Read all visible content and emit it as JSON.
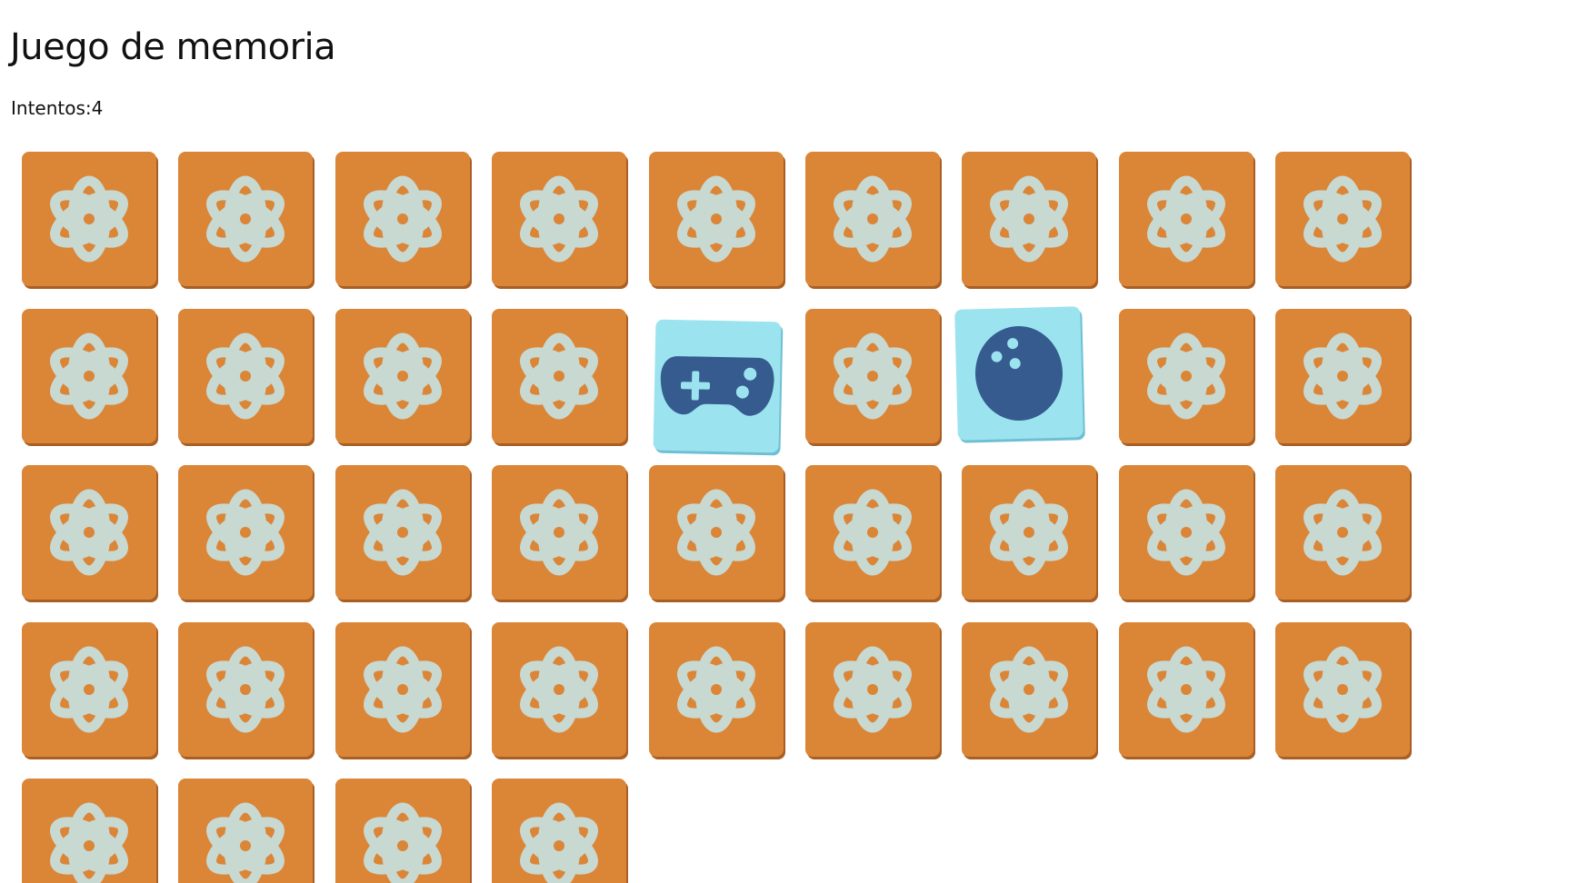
{
  "page": {
    "title": "Juego de memoria",
    "attempts_label": "Intentos:",
    "attempts_value": "4",
    "attempts_text": "Intentos:4"
  },
  "colors": {
    "card_back": "#db8537",
    "card_back_shadow": "#a95f24",
    "card_symbol": "#c8d9d2",
    "card_front": "#9ce3f0",
    "front_icon": "#355b8f"
  },
  "board": {
    "columns": 9,
    "cards": [
      {
        "state": "hidden",
        "icon": "atom-icon"
      },
      {
        "state": "hidden",
        "icon": "atom-icon"
      },
      {
        "state": "hidden",
        "icon": "atom-icon"
      },
      {
        "state": "hidden",
        "icon": "atom-icon"
      },
      {
        "state": "hidden",
        "icon": "atom-icon"
      },
      {
        "state": "hidden",
        "icon": "atom-icon"
      },
      {
        "state": "hidden",
        "icon": "atom-icon"
      },
      {
        "state": "hidden",
        "icon": "atom-icon"
      },
      {
        "state": "hidden",
        "icon": "atom-icon"
      },
      {
        "state": "hidden",
        "icon": "atom-icon"
      },
      {
        "state": "hidden",
        "icon": "atom-icon"
      },
      {
        "state": "hidden",
        "icon": "atom-icon"
      },
      {
        "state": "hidden",
        "icon": "atom-icon"
      },
      {
        "state": "revealed",
        "icon": "gamepad-icon"
      },
      {
        "state": "hidden",
        "icon": "atom-icon"
      },
      {
        "state": "revealed",
        "icon": "bowling-ball-icon"
      },
      {
        "state": "hidden",
        "icon": "atom-icon"
      },
      {
        "state": "hidden",
        "icon": "atom-icon"
      },
      {
        "state": "hidden",
        "icon": "atom-icon"
      },
      {
        "state": "hidden",
        "icon": "atom-icon"
      },
      {
        "state": "hidden",
        "icon": "atom-icon"
      },
      {
        "state": "hidden",
        "icon": "atom-icon"
      },
      {
        "state": "hidden",
        "icon": "atom-icon"
      },
      {
        "state": "hidden",
        "icon": "atom-icon"
      },
      {
        "state": "hidden",
        "icon": "atom-icon"
      },
      {
        "state": "hidden",
        "icon": "atom-icon"
      },
      {
        "state": "hidden",
        "icon": "atom-icon"
      },
      {
        "state": "hidden",
        "icon": "atom-icon"
      },
      {
        "state": "hidden",
        "icon": "atom-icon"
      },
      {
        "state": "hidden",
        "icon": "atom-icon"
      },
      {
        "state": "hidden",
        "icon": "atom-icon"
      },
      {
        "state": "hidden",
        "icon": "atom-icon"
      },
      {
        "state": "hidden",
        "icon": "atom-icon"
      },
      {
        "state": "hidden",
        "icon": "atom-icon"
      },
      {
        "state": "hidden",
        "icon": "atom-icon"
      },
      {
        "state": "hidden",
        "icon": "atom-icon"
      },
      {
        "state": "hidden",
        "icon": "atom-icon"
      },
      {
        "state": "hidden",
        "icon": "atom-icon"
      },
      {
        "state": "hidden",
        "icon": "atom-icon"
      },
      {
        "state": "hidden",
        "icon": "atom-icon"
      }
    ]
  }
}
